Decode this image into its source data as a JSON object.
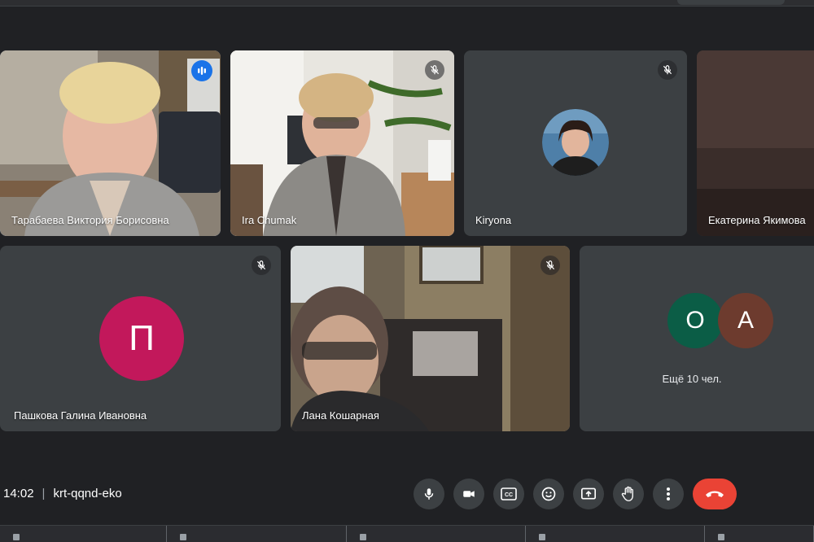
{
  "meeting": {
    "time": "14:02",
    "code": "krt-qqnd-eko"
  },
  "participants": [
    {
      "name": "Тарабаева Виктория Борисовна",
      "speaking": true
    },
    {
      "name": "Ira Chumak",
      "muted": true
    },
    {
      "name": "Kiryona",
      "muted": true
    },
    {
      "name": "Екатерина Якимова"
    },
    {
      "name": "Пашкова Галина Ивановна",
      "muted": true,
      "avatar_letter": "П",
      "avatar_color": "#c2185b"
    },
    {
      "name": "Лана Кошарная",
      "muted": true
    }
  ],
  "others": {
    "avatars": [
      {
        "letter": "О",
        "color": "#0b5d46"
      },
      {
        "letter": "А",
        "color": "#6d3b2e"
      }
    ],
    "caption": "Ещё 10 чел."
  },
  "controls": {
    "microphone": "microphone-icon",
    "camera": "camera-icon",
    "captions": "CC",
    "reactions": "emoji-icon",
    "present": "present-screen-icon",
    "raise_hand": "hand-icon",
    "more": "more-vert-icon",
    "end_call": "hang-up-icon",
    "end_call_color": "#ea4335"
  },
  "colors": {
    "background": "#202124",
    "tile": "#3c4043",
    "active_speaker": "#8ab4f8",
    "accent": "#1a73e8"
  }
}
